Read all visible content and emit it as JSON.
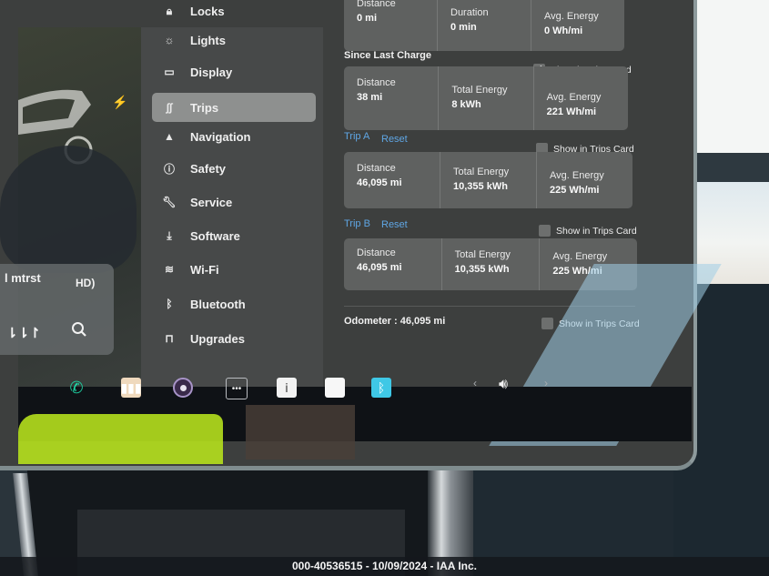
{
  "sidebar": {
    "items": [
      {
        "label": "Locks",
        "icon": "lock-icon"
      },
      {
        "label": "Lights",
        "icon": "sun-icon"
      },
      {
        "label": "Display",
        "icon": "display-icon"
      },
      {
        "label": "Trips",
        "icon": "trips-icon",
        "active": true
      },
      {
        "label": "Navigation",
        "icon": "navigation-arrow-icon"
      },
      {
        "label": "Safety",
        "icon": "alert-circle-icon"
      },
      {
        "label": "Service",
        "icon": "wrench-icon"
      },
      {
        "label": "Software",
        "icon": "download-icon"
      },
      {
        "label": "Wi-Fi",
        "icon": "wifi-icon"
      },
      {
        "label": "Bluetooth",
        "icon": "bluetooth-icon"
      },
      {
        "label": "Upgrades",
        "icon": "shopping-bag-icon"
      }
    ]
  },
  "media": {
    "station": "l mtrst"
  },
  "trips": {
    "current": {
      "show_label_partial": "...ps Card",
      "cells": [
        {
          "label": "Distance",
          "value": "0 mi"
        },
        {
          "label": "Duration",
          "value": "0 min"
        },
        {
          "label": "Avg. Energy",
          "value": "0 Wh/mi"
        }
      ]
    },
    "since_last_charge": {
      "title": "Since Last Charge",
      "show_in_trips_card": "Show in Trips Card",
      "checked": true,
      "cells": [
        {
          "label": "Distance",
          "value": "38 mi"
        },
        {
          "label": "Total Energy",
          "value": "8 kWh"
        },
        {
          "label": "Avg. Energy",
          "value": "221 Wh/mi"
        }
      ]
    },
    "trip_a": {
      "title": "Trip A",
      "reset": "Reset",
      "show_in_trips_card": "Show in Trips Card",
      "checked": false,
      "cells": [
        {
          "label": "Distance",
          "value": "46,095 mi"
        },
        {
          "label": "Total Energy",
          "value": "10,355 kWh"
        },
        {
          "label": "Avg. Energy",
          "value": "225 Wh/mi"
        }
      ]
    },
    "trip_b": {
      "title": "Trip B",
      "reset": "Reset",
      "show_in_trips_card": "Show in Trips Card",
      "checked": false,
      "cells": [
        {
          "label": "Distance",
          "value": "46,095 mi"
        },
        {
          "label": "Total Energy",
          "value": "10,355 kWh"
        },
        {
          "label": "Avg. Energy",
          "value": "225 Wh/mi"
        }
      ]
    },
    "odometer": {
      "text": "Odometer : 46,095 mi",
      "show_in_trips_card": "Show in Trips Card",
      "checked": false
    }
  },
  "dock": {
    "icons": [
      "phone-icon",
      "media-player-icon",
      "camera-icon",
      "more-icon",
      "manual-icon",
      "notes-icon",
      "bluetooth-icon"
    ],
    "volume_icon": "volume-icon",
    "prev": "‹",
    "next": "›",
    "colors": {
      "phone": "#1fd1a2",
      "bluetooth": "#3fc8e6"
    }
  },
  "watermark": "000-40536515 - 10/09/2024 - IAA Inc."
}
